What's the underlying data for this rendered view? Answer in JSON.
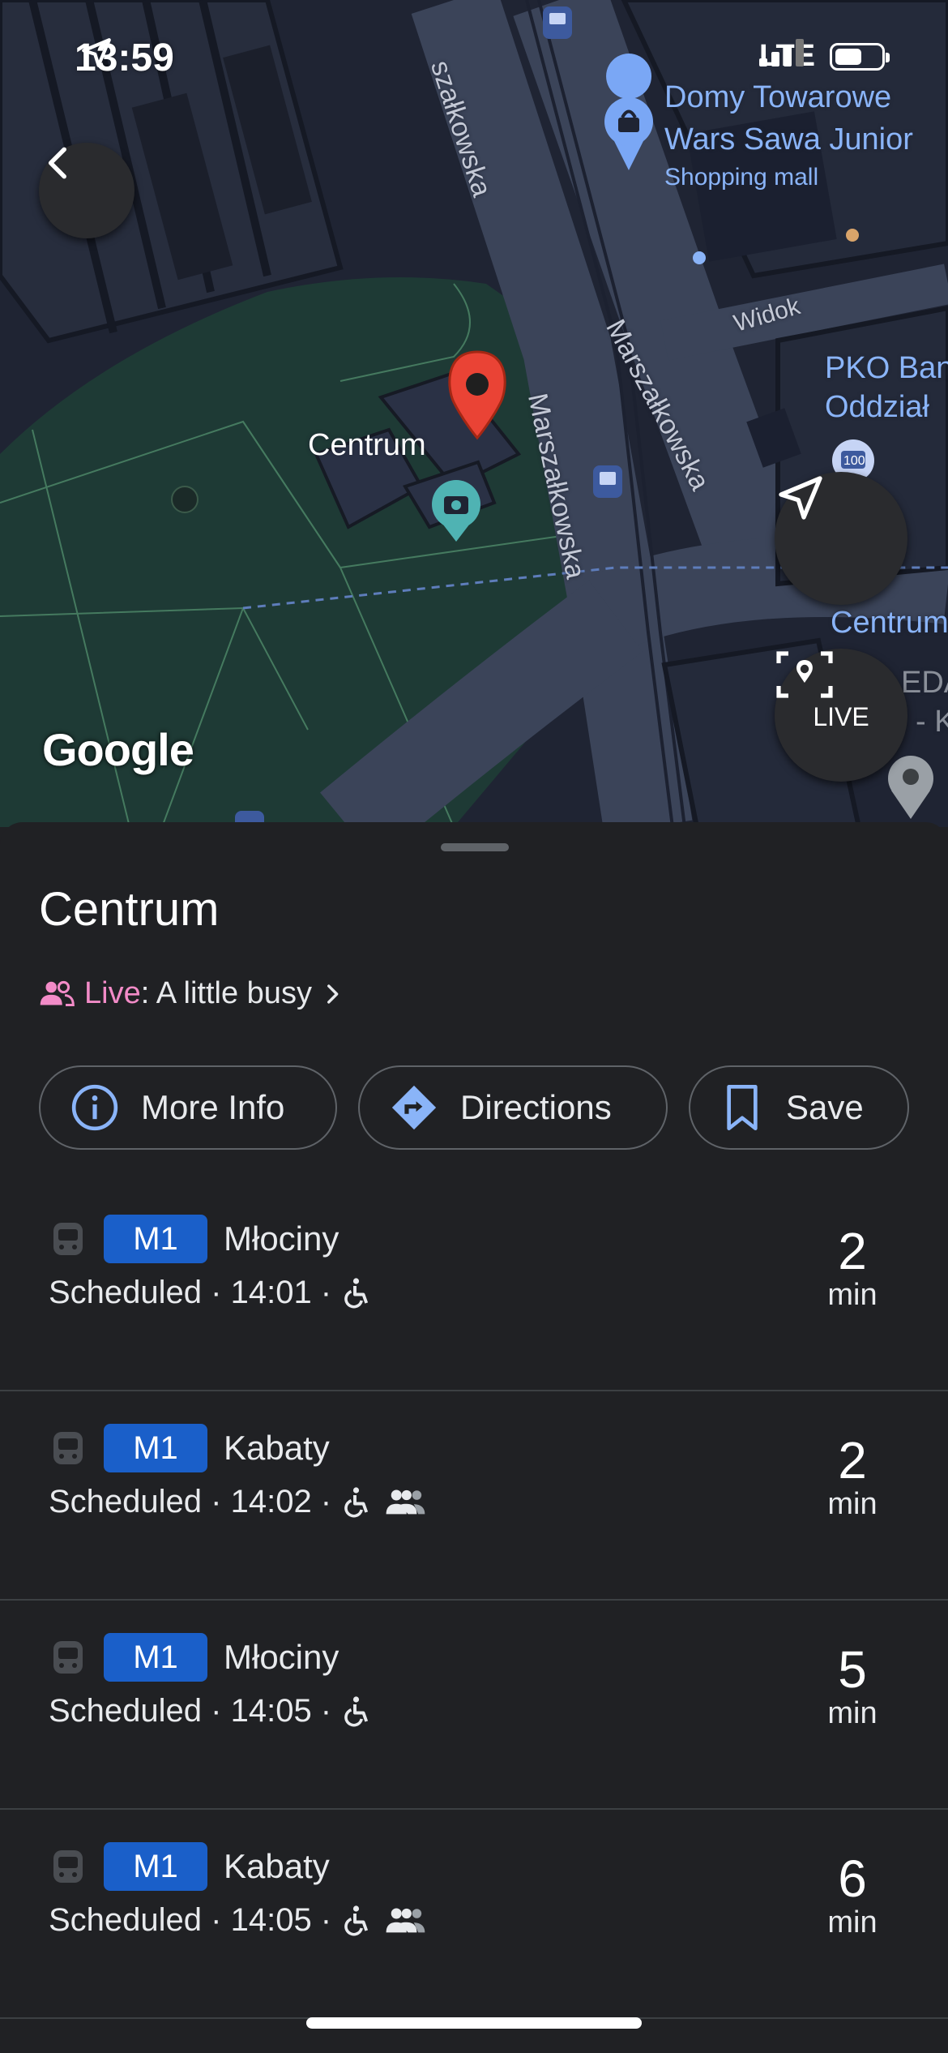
{
  "status_bar": {
    "time": "13:59",
    "network": "LTE"
  },
  "map": {
    "streets": {
      "marszalkowska_top": "szałkowska",
      "marszalkowska_left": "Marszałkowska",
      "marszalkowska_right": "Marszałkowska",
      "widok": "Widok"
    },
    "poi_mall_name_line1": "Domy Towarowe",
    "poi_mall_name_line2": "Wars Sawa Junior",
    "poi_mall_category": "Shopping mall",
    "poi_bank_line1": "PKO Ban",
    "poi_bank_line2": "Oddział",
    "poi_centrum_right": "Centrum",
    "poi_cut_line1": "EDA",
    "poi_cut_line2": "- K",
    "bus_stop_number": "100",
    "selected_place_label": "Centrum",
    "attribution": "Google",
    "live_button_label": "LIVE"
  },
  "sheet": {
    "title": "Centrum",
    "live_prefix": "Live",
    "live_status": ": A little busy",
    "actions": [
      {
        "label": "More Info"
      },
      {
        "label": "Directions"
      },
      {
        "label": "Save"
      }
    ],
    "departures": [
      {
        "line": "M1",
        "destination": "Młociny",
        "status": "Scheduled · 14:01 ·",
        "eta": "2",
        "unit": "min"
      },
      {
        "line": "M1",
        "destination": "Kabaty",
        "status": "Scheduled · 14:02 ·",
        "eta": "2",
        "unit": "min"
      },
      {
        "line": "M1",
        "destination": "Młociny",
        "status": "Scheduled · 14:05 ·",
        "eta": "5",
        "unit": "min"
      },
      {
        "line": "M1",
        "destination": "Kabaty",
        "status": "Scheduled · 14:05 ·",
        "eta": "6",
        "unit": "min"
      }
    ]
  },
  "colors": {
    "map_background": "#1f2433",
    "park": "#1e3a35",
    "road": "#3b4459",
    "pin": "#ea4335",
    "line_badge": "#1a5fc9",
    "live_accent": "#f28bc7",
    "poi_blue": "#8ab4f8"
  }
}
